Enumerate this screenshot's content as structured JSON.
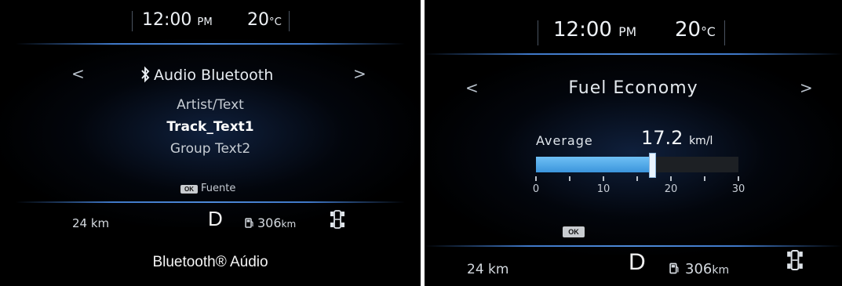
{
  "left_screen": {
    "time": "12:00",
    "time_suffix": "PM",
    "temperature": "20",
    "temperature_unit": "°C",
    "nav_prev": "<",
    "nav_next": ">",
    "title": "Audio Bluetooth",
    "title_icon": "bluetooth-icon",
    "lines": [
      "Artist/Text",
      "Track_Text1",
      "Group Text2"
    ],
    "ok_label": "OK",
    "ok_action": "Fuente",
    "trip_distance": "24 km",
    "gear": "D",
    "range_value": "306",
    "range_unit": "km",
    "caption": "Bluetooth® Aúdio"
  },
  "right_screen": {
    "time": "12:00",
    "time_suffix": "PM",
    "temperature": "20",
    "temperature_unit": "°C",
    "nav_prev": "<",
    "nav_next": ">",
    "title": "Fuel Economy",
    "average_label": "Average",
    "average_value": "17.2",
    "average_unit": "km/l",
    "gauge": {
      "min": 0,
      "max": 30,
      "value": 17.2,
      "tick_labels": [
        "0",
        "10",
        "20",
        "30"
      ]
    },
    "ok_label": "OK",
    "trip_distance": "24 km",
    "gear": "D",
    "range_value": "306",
    "range_unit": "km"
  },
  "colors": {
    "accent_blue": "#4aa2e8",
    "background": "#000000",
    "divider": "#3f78c8"
  }
}
